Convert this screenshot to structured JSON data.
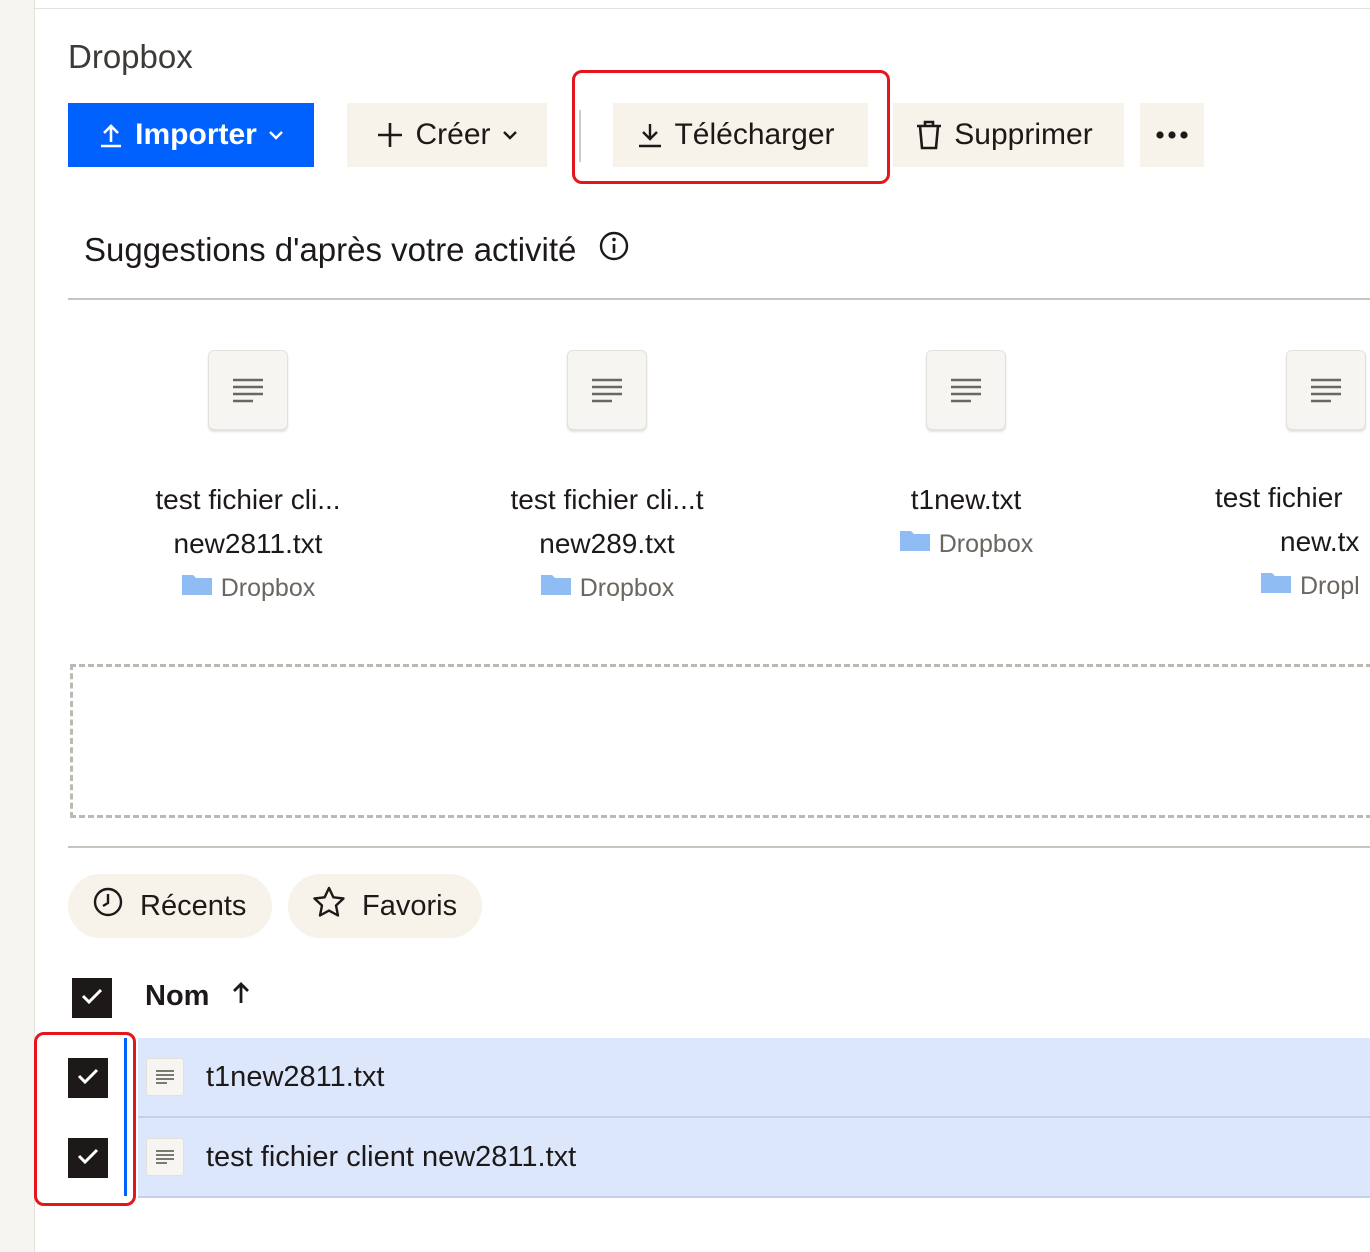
{
  "header": {
    "title": "Dropbox"
  },
  "toolbar": {
    "import_label": "Importer",
    "create_label": "Créer",
    "download_label": "Télécharger",
    "delete_label": "Supprimer"
  },
  "suggestions": {
    "title": "Suggestions d'après votre activité",
    "items": [
      {
        "name_line1": "test fichier cli...",
        "name_line2": "new2811.txt",
        "location": "Dropbox"
      },
      {
        "name_line1": "test fichier cli...t",
        "name_line2": "new289.txt",
        "location": "Dropbox"
      },
      {
        "name_line1": "t1new.txt",
        "name_line2": "",
        "location": "Dropbox"
      },
      {
        "name_line1": "test fichier",
        "name_line2": "new.tx",
        "location": "Dropl"
      }
    ]
  },
  "filters": {
    "recents_label": "Récents",
    "favorites_label": "Favoris"
  },
  "file_list": {
    "column_name": "Nom",
    "rows": [
      {
        "name": "t1new2811.txt",
        "selected": true
      },
      {
        "name": "test fichier client new2811.txt",
        "selected": true
      }
    ]
  },
  "colors": {
    "accent": "#0061fe",
    "highlight": "#e5151c",
    "selected_row": "#dce7fb",
    "button_bg": "#f7f2ea"
  },
  "icons": [
    "upload-icon",
    "chevron-down-icon",
    "plus-icon",
    "download-icon",
    "trash-icon",
    "more-icon",
    "info-icon",
    "text-file-icon",
    "folder-icon",
    "clock-icon",
    "star-icon",
    "sort-up-icon",
    "checkmark-icon"
  ]
}
